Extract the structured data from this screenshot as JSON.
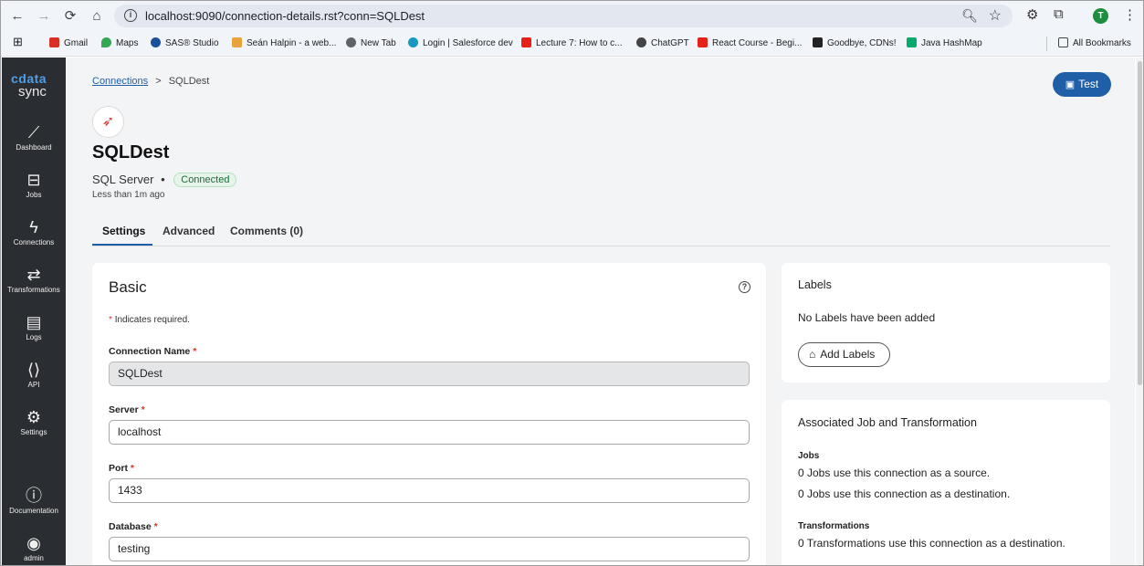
{
  "browser": {
    "url": "localhost:9090/connection-details.rst?conn=SQLDest",
    "profile_initial": "T",
    "bookmarks": [
      {
        "label": "Gmail",
        "color": "#d93025"
      },
      {
        "label": "Maps",
        "color": "#34a853"
      },
      {
        "label": "SAS® Studio",
        "color": "#1a4f9c"
      },
      {
        "label": "Seán Halpin - a web...",
        "color": "#e8a33d"
      },
      {
        "label": "New Tab",
        "color": "#5f6368"
      },
      {
        "label": "Login | Salesforce dev",
        "color": "#1798c1"
      },
      {
        "label": "Lecture 7: How to c...",
        "color": "#e62117"
      },
      {
        "label": "ChatGPT",
        "color": "#444444"
      },
      {
        "label": "React Course - Begi...",
        "color": "#e62117"
      },
      {
        "label": "Goodbye, CDNs!",
        "color": "#222222"
      },
      {
        "label": "Java HashMap",
        "color": "#04aa6d"
      }
    ],
    "all_bookmarks": "All Bookmarks"
  },
  "sidebar": {
    "brand": "cdata",
    "product": "sync",
    "items": [
      {
        "label": "Dashboard",
        "icon": "chart-icon"
      },
      {
        "label": "Jobs",
        "icon": "briefcase-icon"
      },
      {
        "label": "Connections",
        "icon": "bolt-icon"
      },
      {
        "label": "Transformations",
        "icon": "arrows-icon"
      },
      {
        "label": "Logs",
        "icon": "book-icon"
      },
      {
        "label": "API",
        "icon": "api-icon"
      },
      {
        "label": "Settings",
        "icon": "gear-icon"
      }
    ],
    "bottom": [
      {
        "label": "Documentation",
        "icon": "help-icon"
      },
      {
        "label": "admin",
        "icon": "user-icon"
      }
    ]
  },
  "breadcrumb": {
    "root": "Connections",
    "separator": ">",
    "current": "SQLDest"
  },
  "header": {
    "title": "SQLDest",
    "type": "SQL Server",
    "dot": "•",
    "status": "Connected",
    "updated": "Less than 1m ago",
    "test_label": "Test"
  },
  "tabs": [
    "Settings",
    "Advanced",
    "Comments (0)"
  ],
  "basic": {
    "title": "Basic",
    "required_note": "Indicates required.",
    "fields": [
      {
        "label": "Connection Name",
        "value": "SQLDest"
      },
      {
        "label": "Server",
        "value": "localhost"
      },
      {
        "label": "Port",
        "value": "1433"
      },
      {
        "label": "Database",
        "value": "testing"
      }
    ]
  },
  "labels_card": {
    "title": "Labels",
    "empty": "No Labels have been added",
    "add": "Add Labels"
  },
  "assoc_card": {
    "title": "Associated Job and Transformation",
    "jobs_title": "Jobs",
    "jobs_source": "0 Jobs use this connection as a source.",
    "jobs_dest": "0 Jobs use this connection as a destination.",
    "trans_title": "Transformations",
    "trans_dest": "0 Transformations use this connection as a destination."
  },
  "colors": {
    "accent": "#1f5fa8",
    "sidebar": "#2a2d31",
    "status_bg": "#e6f4ea",
    "required": "#d9342b"
  }
}
